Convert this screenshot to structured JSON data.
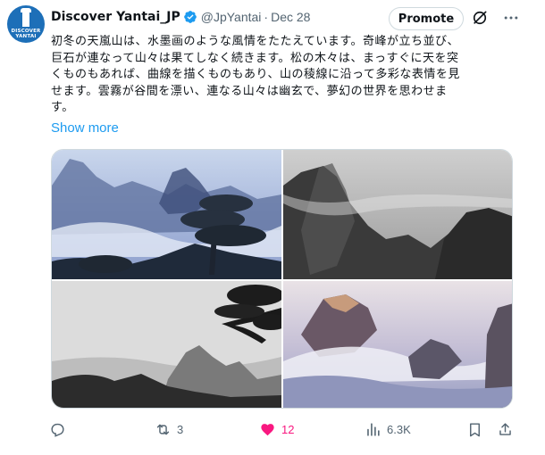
{
  "author": {
    "display_name": "Discover Yantai_JP",
    "handle": "@JpYantai",
    "separator": "·",
    "date": "Dec 28",
    "avatar_text": [
      "DISCOVER",
      "YANTAI"
    ]
  },
  "header_actions": {
    "promote_label": "Promote"
  },
  "tweet": {
    "lines": [
      "初冬の天嵐山は、水墨画のような風情をたたえています。奇峰が立ち並び、",
      "巨石が連なって山々は果てしなく続きます。松の木々は、まっすぐに天を突",
      "くものもあれば、曲線を描くものもあり、山の稜線に沿って多彩な表情を見",
      "せます。雲霧が谷間を漂い、連なる山々は幽玄で、夢幻の世界を思わせま",
      "す。"
    ],
    "show_more": "Show more"
  },
  "media": {
    "image_count": 4
  },
  "actions": {
    "reply_count": "",
    "retweet_count": "3",
    "like_count": "12",
    "views_count": "6.3K"
  },
  "colors": {
    "accent_blue": "#1d9bf0",
    "like_pink": "#f91880",
    "muted_gray": "#536471",
    "verified_blue": "#1d9bf0"
  }
}
